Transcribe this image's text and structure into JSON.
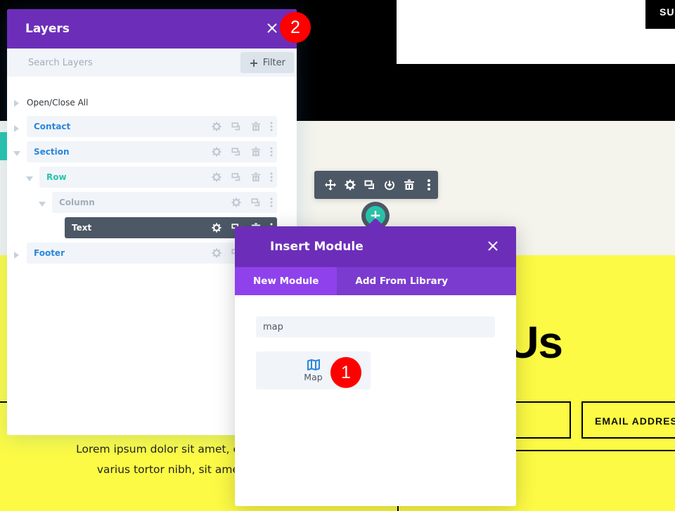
{
  "background_page": {
    "submit_button_fragment": "SU",
    "heading_fragment": "Us",
    "email_field_placeholder": "EMAIL ADDRESS",
    "lorem_lines": [
      "Lorem ipsum dolor sit amet, consectetur adi",
      "varius tortor nibh, sit amet tempor n"
    ],
    "colors": {
      "top_black": "#000000",
      "section_offwhite": "#f4f3ec",
      "yellow": "#fcfa44",
      "teal_accent": "#29c4a9"
    }
  },
  "module_toolbar": {
    "icons": [
      "move-icon",
      "gear-icon",
      "duplicate-icon",
      "save-to-library-icon",
      "trash-icon",
      "more-dots-icon"
    ]
  },
  "add_module_button": {
    "label": "+"
  },
  "layers_panel": {
    "title": "Layers",
    "close_icon": "close-icon",
    "search_placeholder": "Search Layers",
    "filter_button": {
      "icon": "+",
      "label": "Filter"
    },
    "open_close_all": "Open/Close All",
    "tree": [
      {
        "label": "Contact",
        "level": 0,
        "type": "section",
        "toggle": "collapsed",
        "color": "#2b87da",
        "actions": [
          "gear",
          "duplicate",
          "trash",
          "more"
        ]
      },
      {
        "label": "Section",
        "level": 0,
        "type": "section",
        "toggle": "expanded",
        "color": "#2b87da",
        "actions": [
          "gear",
          "duplicate",
          "trash",
          "more"
        ]
      },
      {
        "label": "Row",
        "level": 1,
        "type": "row",
        "toggle": "expanded",
        "color": "#29c4a9",
        "actions": [
          "gear",
          "duplicate",
          "trash",
          "more"
        ]
      },
      {
        "label": "Column",
        "level": 2,
        "type": "column",
        "toggle": "expanded",
        "color": "#a3adba",
        "actions": [
          "gear",
          "duplicate",
          "more"
        ]
      },
      {
        "label": "Text",
        "level": 3,
        "type": "module",
        "toggle": "none",
        "color": "#ffffff",
        "selected": true,
        "actions": [
          "gear",
          "duplicate",
          "trash",
          "more"
        ]
      },
      {
        "label": "Footer",
        "level": 0,
        "type": "section",
        "toggle": "collapsed",
        "color": "#2b87da",
        "actions": [
          "gear",
          "duplicate",
          "trash",
          "more"
        ]
      }
    ],
    "colors": {
      "header": "#6c2eb9",
      "selected_row": "#4c5866"
    }
  },
  "insert_module": {
    "title": "Insert Module",
    "close_icon": "close-icon",
    "tabs": [
      {
        "label": "New Module",
        "active": true
      },
      {
        "label": "Add From Library",
        "active": false
      }
    ],
    "search_value": "map",
    "results": [
      {
        "label": "Map",
        "icon": "map-icon"
      }
    ],
    "colors": {
      "header": "#6c2eb9",
      "tabs": "#7b3bcf",
      "active_tab": "#8f42ec",
      "icon": "#2b87da"
    }
  },
  "annotations": [
    {
      "number": "1",
      "target": "map-module-tile"
    },
    {
      "number": "2",
      "target": "layers-close-button"
    }
  ]
}
